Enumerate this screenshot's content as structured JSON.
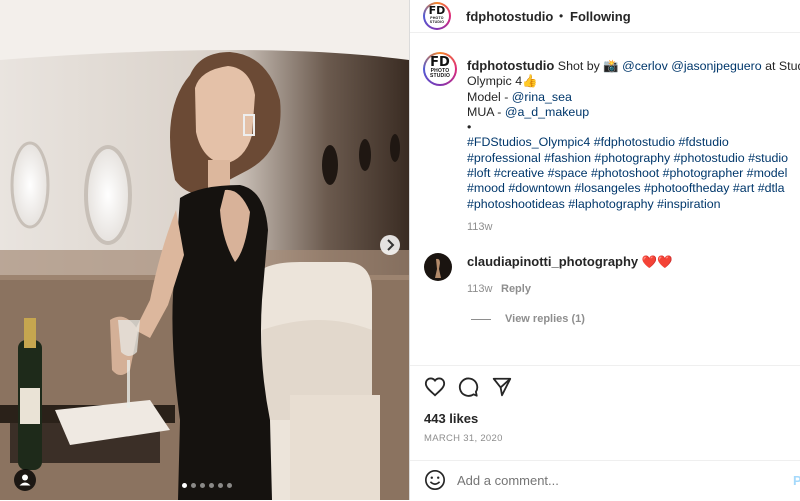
{
  "post": {
    "username": "fdphotostudio",
    "follow_state": "Following",
    "header_separator": "•",
    "avatar_logo": {
      "main": "FD",
      "sub1": "PHOTO",
      "sub2": "STUDIO"
    },
    "carousel": {
      "total": 6,
      "current": 1
    }
  },
  "caption": {
    "username": "fdphotostudio",
    "line1": {
      "text": " Shot by 📸 ",
      "mentions": [
        "@cerlov",
        "@jasonjpeguero"
      ],
      "tail": " at Studio"
    },
    "line2": "Olympic 4👍",
    "model_label": "Model - ",
    "model_mention": "@rina_sea",
    "mua_label": "MUA - ",
    "mua_mention": "@a_d_makeup",
    "bullet": "•",
    "hashtag_lines": [
      "#FDStudios_Olympic4 #fdphotostudio #fdstudio",
      "#professional #fashion #photography #photostudio #studio",
      "#loft #creative #space #photoshoot #photographer #model",
      "#mood #downtown #losangeles #photooftheday #art #dtla",
      "#photoshootideas #laphotography #inspiration"
    ],
    "time": "113w"
  },
  "comment": {
    "username": "claudiapinotti_photography",
    "text": " ❤️❤️",
    "time": "113w",
    "reply_label": "Reply",
    "view_replies": "View replies (1)"
  },
  "stats": {
    "likes": "443 likes",
    "date": "MARCH 31, 2020"
  },
  "add_comment": {
    "placeholder": "Add a comment...",
    "post_label": "P"
  },
  "colors": {
    "link": "#00376b",
    "muted": "#8e8e8e",
    "post_button": "#0095f6"
  }
}
